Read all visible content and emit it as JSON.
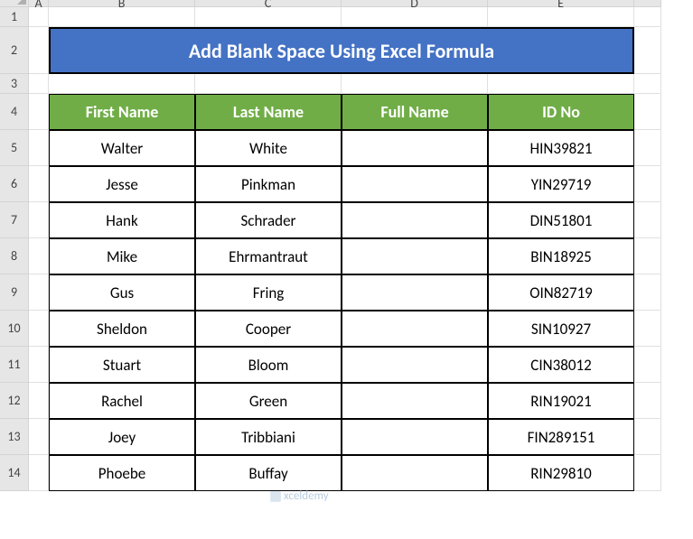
{
  "columns": [
    "A",
    "B",
    "C",
    "D",
    "E"
  ],
  "rows": [
    "1",
    "2",
    "3",
    "4",
    "5",
    "6",
    "7",
    "8",
    "9",
    "10",
    "11",
    "12",
    "13",
    "14"
  ],
  "title": "Add Blank Space Using Excel Formula",
  "headers": {
    "b": "First Name",
    "c": "Last Name",
    "d": "Full Name",
    "e": "ID No"
  },
  "data": [
    {
      "first": "Walter",
      "last": "White",
      "full": "",
      "id": "HIN39821"
    },
    {
      "first": "Jesse",
      "last": "Pinkman",
      "full": "",
      "id": "YIN29719"
    },
    {
      "first": "Hank",
      "last": "Schrader",
      "full": "",
      "id": "DIN51801"
    },
    {
      "first": "Mike",
      "last": "Ehrmantraut",
      "full": "",
      "id": "BIN18925"
    },
    {
      "first": "Gus",
      "last": "Fring",
      "full": "",
      "id": "OIN82719"
    },
    {
      "first": "Sheldon",
      "last": "Cooper",
      "full": "",
      "id": "SIN10927"
    },
    {
      "first": "Stuart",
      "last": "Bloom",
      "full": "",
      "id": "CIN38012"
    },
    {
      "first": "Rachel",
      "last": "Green",
      "full": "",
      "id": "RIN19021"
    },
    {
      "first": "Joey",
      "last": "Tribbiani",
      "full": "",
      "id": "FIN289151"
    },
    {
      "first": "Phoebe",
      "last": "Buffay",
      "full": "",
      "id": "RIN29810"
    }
  ],
  "watermark": "xceldemy"
}
